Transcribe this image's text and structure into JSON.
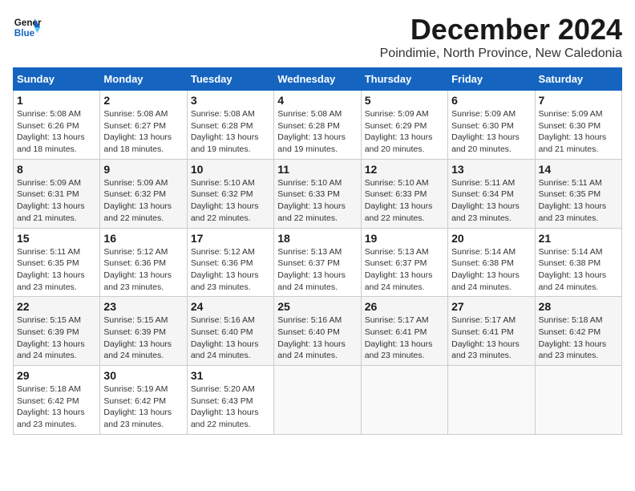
{
  "logo": {
    "line1": "General",
    "line2": "Blue"
  },
  "title": "December 2024",
  "subtitle": "Poindimie, North Province, New Caledonia",
  "days_of_week": [
    "Sunday",
    "Monday",
    "Tuesday",
    "Wednesday",
    "Thursday",
    "Friday",
    "Saturday"
  ],
  "weeks": [
    [
      {
        "day": "1",
        "info": "Sunrise: 5:08 AM\nSunset: 6:26 PM\nDaylight: 13 hours\nand 18 minutes."
      },
      {
        "day": "2",
        "info": "Sunrise: 5:08 AM\nSunset: 6:27 PM\nDaylight: 13 hours\nand 18 minutes."
      },
      {
        "day": "3",
        "info": "Sunrise: 5:08 AM\nSunset: 6:28 PM\nDaylight: 13 hours\nand 19 minutes."
      },
      {
        "day": "4",
        "info": "Sunrise: 5:08 AM\nSunset: 6:28 PM\nDaylight: 13 hours\nand 19 minutes."
      },
      {
        "day": "5",
        "info": "Sunrise: 5:09 AM\nSunset: 6:29 PM\nDaylight: 13 hours\nand 20 minutes."
      },
      {
        "day": "6",
        "info": "Sunrise: 5:09 AM\nSunset: 6:30 PM\nDaylight: 13 hours\nand 20 minutes."
      },
      {
        "day": "7",
        "info": "Sunrise: 5:09 AM\nSunset: 6:30 PM\nDaylight: 13 hours\nand 21 minutes."
      }
    ],
    [
      {
        "day": "8",
        "info": "Sunrise: 5:09 AM\nSunset: 6:31 PM\nDaylight: 13 hours\nand 21 minutes."
      },
      {
        "day": "9",
        "info": "Sunrise: 5:09 AM\nSunset: 6:32 PM\nDaylight: 13 hours\nand 22 minutes."
      },
      {
        "day": "10",
        "info": "Sunrise: 5:10 AM\nSunset: 6:32 PM\nDaylight: 13 hours\nand 22 minutes."
      },
      {
        "day": "11",
        "info": "Sunrise: 5:10 AM\nSunset: 6:33 PM\nDaylight: 13 hours\nand 22 minutes."
      },
      {
        "day": "12",
        "info": "Sunrise: 5:10 AM\nSunset: 6:33 PM\nDaylight: 13 hours\nand 22 minutes."
      },
      {
        "day": "13",
        "info": "Sunrise: 5:11 AM\nSunset: 6:34 PM\nDaylight: 13 hours\nand 23 minutes."
      },
      {
        "day": "14",
        "info": "Sunrise: 5:11 AM\nSunset: 6:35 PM\nDaylight: 13 hours\nand 23 minutes."
      }
    ],
    [
      {
        "day": "15",
        "info": "Sunrise: 5:11 AM\nSunset: 6:35 PM\nDaylight: 13 hours\nand 23 minutes."
      },
      {
        "day": "16",
        "info": "Sunrise: 5:12 AM\nSunset: 6:36 PM\nDaylight: 13 hours\nand 23 minutes."
      },
      {
        "day": "17",
        "info": "Sunrise: 5:12 AM\nSunset: 6:36 PM\nDaylight: 13 hours\nand 23 minutes."
      },
      {
        "day": "18",
        "info": "Sunrise: 5:13 AM\nSunset: 6:37 PM\nDaylight: 13 hours\nand 24 minutes."
      },
      {
        "day": "19",
        "info": "Sunrise: 5:13 AM\nSunset: 6:37 PM\nDaylight: 13 hours\nand 24 minutes."
      },
      {
        "day": "20",
        "info": "Sunrise: 5:14 AM\nSunset: 6:38 PM\nDaylight: 13 hours\nand 24 minutes."
      },
      {
        "day": "21",
        "info": "Sunrise: 5:14 AM\nSunset: 6:38 PM\nDaylight: 13 hours\nand 24 minutes."
      }
    ],
    [
      {
        "day": "22",
        "info": "Sunrise: 5:15 AM\nSunset: 6:39 PM\nDaylight: 13 hours\nand 24 minutes."
      },
      {
        "day": "23",
        "info": "Sunrise: 5:15 AM\nSunset: 6:39 PM\nDaylight: 13 hours\nand 24 minutes."
      },
      {
        "day": "24",
        "info": "Sunrise: 5:16 AM\nSunset: 6:40 PM\nDaylight: 13 hours\nand 24 minutes."
      },
      {
        "day": "25",
        "info": "Sunrise: 5:16 AM\nSunset: 6:40 PM\nDaylight: 13 hours\nand 24 minutes."
      },
      {
        "day": "26",
        "info": "Sunrise: 5:17 AM\nSunset: 6:41 PM\nDaylight: 13 hours\nand 23 minutes."
      },
      {
        "day": "27",
        "info": "Sunrise: 5:17 AM\nSunset: 6:41 PM\nDaylight: 13 hours\nand 23 minutes."
      },
      {
        "day": "28",
        "info": "Sunrise: 5:18 AM\nSunset: 6:42 PM\nDaylight: 13 hours\nand 23 minutes."
      }
    ],
    [
      {
        "day": "29",
        "info": "Sunrise: 5:18 AM\nSunset: 6:42 PM\nDaylight: 13 hours\nand 23 minutes."
      },
      {
        "day": "30",
        "info": "Sunrise: 5:19 AM\nSunset: 6:42 PM\nDaylight: 13 hours\nand 23 minutes."
      },
      {
        "day": "31",
        "info": "Sunrise: 5:20 AM\nSunset: 6:43 PM\nDaylight: 13 hours\nand 22 minutes."
      },
      {
        "day": "",
        "info": ""
      },
      {
        "day": "",
        "info": ""
      },
      {
        "day": "",
        "info": ""
      },
      {
        "day": "",
        "info": ""
      }
    ]
  ]
}
